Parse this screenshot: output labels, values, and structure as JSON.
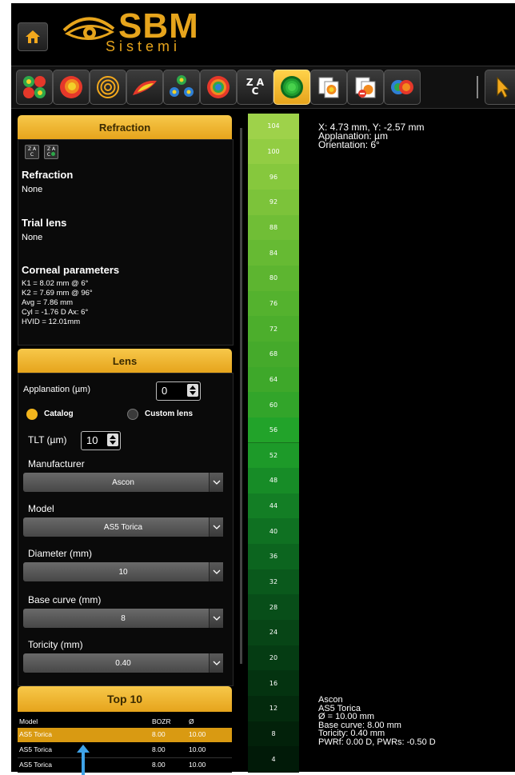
{
  "header": {
    "logo_brand": "SBM",
    "logo_sub": "Sistemi"
  },
  "toolbar": {
    "tools": [
      {
        "icon": "multi-map-icon"
      },
      {
        "icon": "axial-map-icon"
      },
      {
        "icon": "keratoscope-rings-icon"
      },
      {
        "icon": "3d-map-icon"
      },
      {
        "icon": "quad-map-icon"
      },
      {
        "icon": "tangential-map-icon"
      },
      {
        "icon": "z-a-c-sort-icon",
        "label_top": "Z A",
        "label_bottom": "C"
      },
      {
        "icon": "contact-lens-fluorescein-icon",
        "active": true
      },
      {
        "icon": "copy-map-icon"
      },
      {
        "icon": "remove-map-icon"
      },
      {
        "icon": "compare-maps-icon"
      }
    ],
    "cursor_icon": "pointer-cursor-icon"
  },
  "refraction_panel": {
    "title": "Refraction",
    "btn1": "Z A\nC",
    "btn2": "Z A\nC",
    "refraction_heading": "Refraction",
    "refraction_value": "None",
    "trial_heading": "Trial lens",
    "trial_value": "None",
    "corneal_heading": "Corneal parameters",
    "corneal_lines": [
      "K1 = 8.02 mm @ 6°",
      "K2 = 7.69 mm @ 96°",
      "Avg = 7.86 mm",
      "Cyl = -1.76 D Ax: 6°",
      "HVID = 12.01mm"
    ]
  },
  "lens_panel": {
    "title": "Lens",
    "applanation_label": "Applanation (µm)",
    "applanation_value": "0",
    "catalog_label": "Catalog",
    "custom_label": "Custom lens",
    "tlt_label": "TLT (µm)",
    "tlt_value": "10",
    "manufacturer_label": "Manufacturer",
    "manufacturer_value": "Ascon",
    "model_label": "Model",
    "model_value": "AS5 Torica",
    "diameter_label": "Diameter (mm)",
    "diameter_value": "10",
    "basecurve_label": "Base curve (mm)",
    "basecurve_value": "8",
    "toricity_label": "Toricity (mm)",
    "toricity_value": "0.40"
  },
  "top10": {
    "title": "Top 10",
    "headers": [
      "Model",
      "BOZR",
      "Ø"
    ],
    "rows": [
      [
        "AS5 Torica",
        "8.00",
        "10.00"
      ],
      [
        "AS5 Torica",
        "8.00",
        "10.00"
      ],
      [
        "AS5 Torica",
        "8.00",
        "10.00"
      ]
    ]
  },
  "scale": {
    "values": [
      "104",
      "100",
      "96",
      "92",
      "88",
      "84",
      "80",
      "76",
      "72",
      "68",
      "64",
      "60",
      "56",
      "52",
      "48",
      "44",
      "40",
      "36",
      "32",
      "28",
      "24",
      "20",
      "16",
      "12",
      "8",
      "4"
    ],
    "colors": [
      "#9ed24a",
      "#92cd43",
      "#86c83d",
      "#7cc33a",
      "#70be36",
      "#66ba33",
      "#5db530",
      "#54b22e",
      "#4cae2c",
      "#45aa2b",
      "#3ea82a",
      "#32a52a",
      "#22a32a",
      "#1d9a29",
      "#178c27",
      "#137e25",
      "#0f7122",
      "#0c651f",
      "#0a591c",
      "#084e19",
      "#074516",
      "#053c13",
      "#043310",
      "#032a0d",
      "#02210a",
      "#011a08"
    ]
  },
  "map_info": {
    "lines": [
      "X: 4.73 mm, Y: -2.57 mm",
      "Applanation:  µm",
      "Orientation: 6°"
    ]
  },
  "lens_info": {
    "lines": [
      "Ascon",
      "AS5 Torica",
      "Ø = 10.00 mm",
      "Base curve: 8.00 mm",
      "Toricity: 0.40 mm",
      "PWRf: 0.00 D, PWRs: -0.50 D"
    ]
  },
  "colors": {
    "accent": "#e6a41c",
    "selected_row": "#d99a12"
  }
}
